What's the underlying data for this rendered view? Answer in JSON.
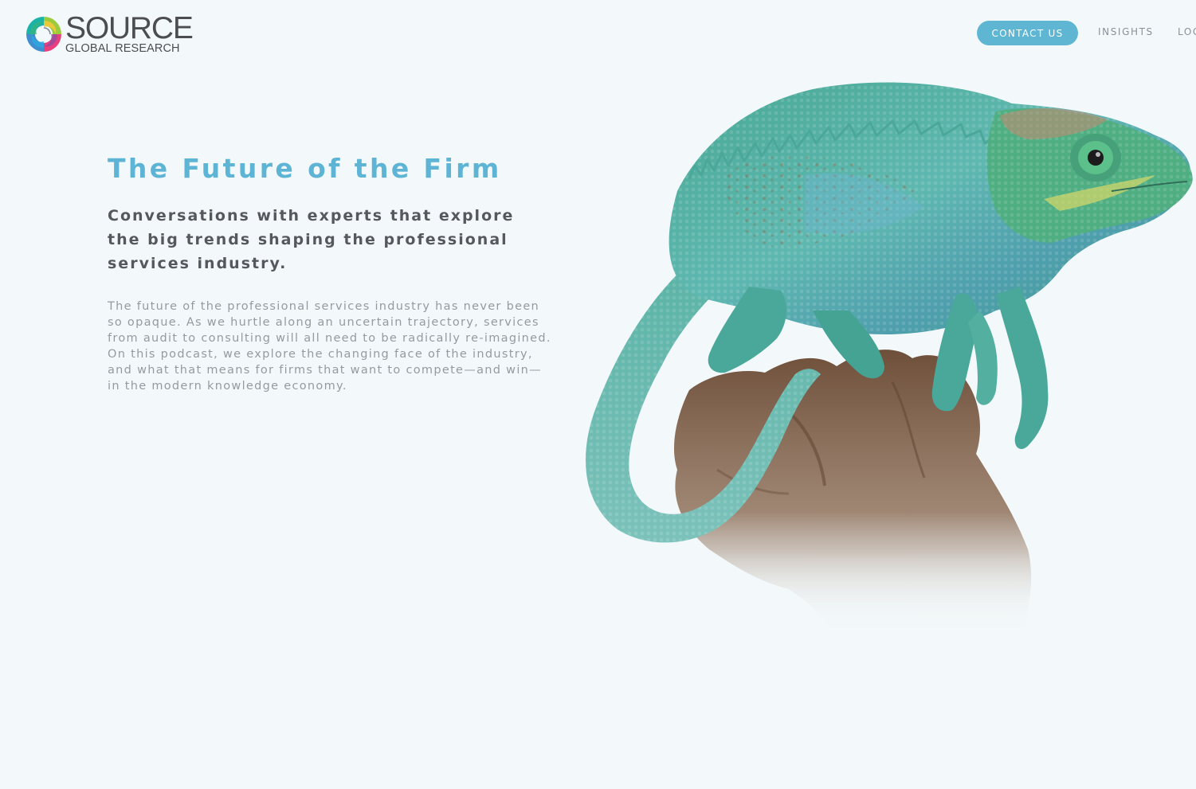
{
  "header": {
    "logo": {
      "word": "SOURCE",
      "subline": "GLOBAL RESEARCH",
      "icon": "swirl-logo-icon"
    },
    "nav": {
      "contact_label": "CONTACT US",
      "insights_label": "INSIGHTS",
      "login_label": "LOG"
    }
  },
  "hero": {
    "title": "The Future of the Firm",
    "subtitle": "Conversations with experts that explore the big trends shaping the professional services industry.",
    "body": "The future of the professional services industry has never been so opaque. As we hurtle along an uncertain trajectory, services from audit to consulting will all need to be radically re-imagined. On this podcast, we explore the changing face of the industry, and what that means for firms that want to compete—and win—in the modern knowledge economy."
  },
  "colors": {
    "background": "#f3f9fb",
    "accent": "#5db4d4",
    "heading_dark": "#55585d",
    "body_text": "#959aa0",
    "chameleon": "#4fae9f",
    "branch": "#7a5a43"
  }
}
